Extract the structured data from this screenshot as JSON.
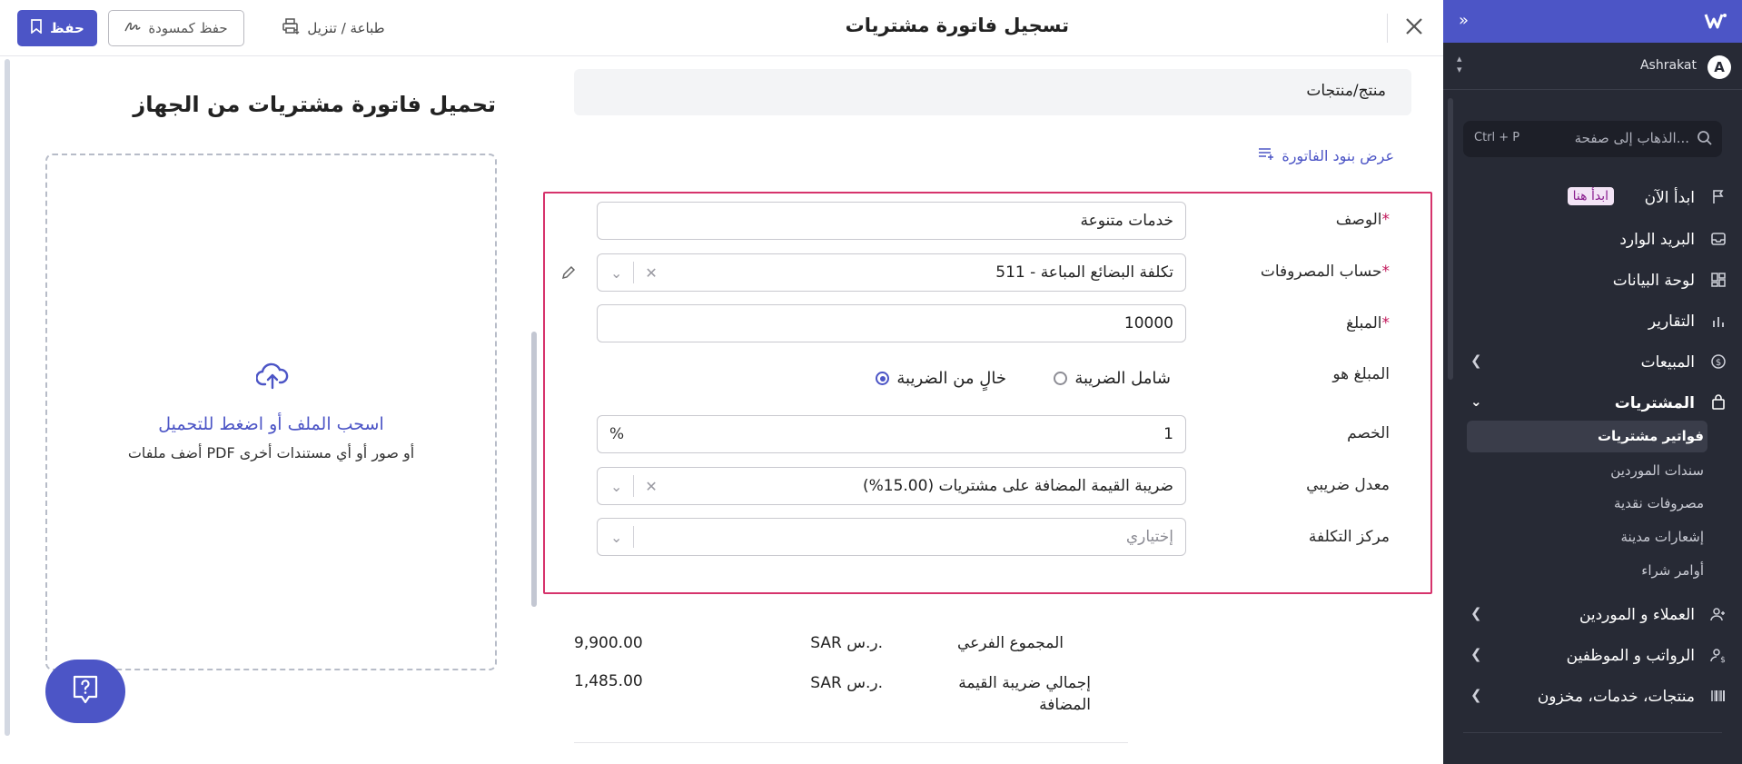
{
  "header": {
    "title": "تسجيل فاتورة مشتريات",
    "save_label": "حفظ",
    "draft_label": "حفظ كمسودة",
    "print_label": "طباعة / تنزيل"
  },
  "sidebar": {
    "user_initial": "A",
    "user_name": "Ashrakat",
    "search_placeholder": "الذهاب إلى صفحة...",
    "search_shortcut": "Ctrl + P",
    "items": [
      {
        "label": "ابدأ الآن",
        "badge": "ابدأ هنا"
      },
      {
        "label": "البريد الوارد"
      },
      {
        "label": "لوحة البيانات"
      },
      {
        "label": "التقارير"
      },
      {
        "label": "المبيعات"
      },
      {
        "label": "المشتريات"
      },
      {
        "label": "العملاء و الموردين"
      },
      {
        "label": "الرواتب و الموظفين"
      },
      {
        "label": "منتجات، خدمات، مخزون"
      }
    ],
    "purchases_sub": [
      "فواتير مشتريات",
      "سندات الموردين",
      "مصروفات نقدية",
      "إشعارات مدينة",
      "أوامر شراء"
    ]
  },
  "form": {
    "section_header": "منتج/منتجات",
    "show_items_link": "عرض بنود الفاتورة",
    "description_label": "الوصف",
    "description_value": "خدمات متنوعة",
    "expense_account_label": "حساب المصروفات",
    "expense_account_value": "511 - تكلفة البضائع المباعة",
    "amount_label": "المبلغ",
    "amount_value": "10000",
    "amount_is_label": "المبلغ هو",
    "tax_inclusive_label": "شامل الضريبة",
    "tax_exclusive_label": "خالٍ من الضريبة",
    "tax_inclusive_selected": false,
    "tax_exclusive_selected": true,
    "discount_label": "الخصم",
    "discount_value": "1",
    "discount_unit": "%",
    "tax_rate_label": "معدل ضريبي",
    "tax_rate_value": "ضريبة القيمة المضافة على مشتريات (15.00%)",
    "cost_center_label": "مركز التكلفة",
    "cost_center_placeholder": "إختياري"
  },
  "summary": {
    "subtotal_label": "المجموع الفرعي",
    "subtotal_currency": "SAR ر.س.",
    "subtotal_value": "9,900.00",
    "vat_label": "إجمالي ضريبة القيمة المضافة",
    "vat_currency": "SAR ر.س.",
    "vat_value": "1,485.00"
  },
  "upload": {
    "title": "تحميل فاتورة مشتريات من الجهاز",
    "drop_text": "اسحب الملف أو اضغط للتحميل",
    "hint": "أضف ملفات PDF أو صور أو أي مستندات أخرى"
  },
  "colors": {
    "accent": "#4c55c6",
    "sidebar_bg": "#272a35",
    "highlight": "#d6336c",
    "badge_bg": "#f3e4f6",
    "badge_text": "#8a1f8f"
  }
}
